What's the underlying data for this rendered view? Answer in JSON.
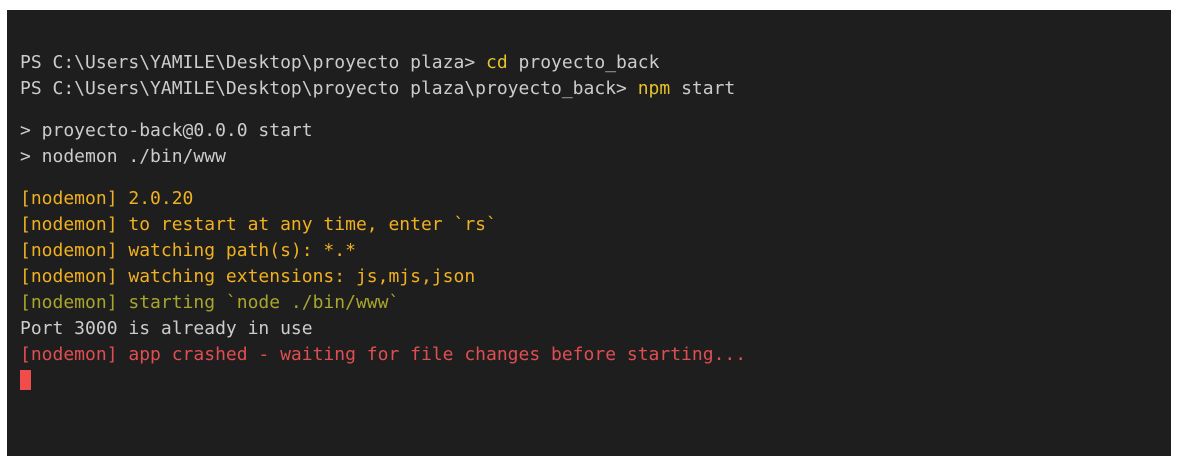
{
  "terminal": {
    "prompt1": {
      "prefix": "PS C:\\Users\\YAMILE\\Desktop\\proyecto plaza> ",
      "command": "cd",
      "args": " proyecto_back"
    },
    "prompt2": {
      "prefix": "PS C:\\Users\\YAMILE\\Desktop\\proyecto plaza\\proyecto_back> ",
      "command": "npm",
      "args": " start"
    },
    "npm_lines": [
      "> proyecto-back@0.0.0 start",
      "> nodemon ./bin/www"
    ],
    "nodemon_info": [
      "[nodemon] 2.0.20",
      "[nodemon] to restart at any time, enter `rs`",
      "[nodemon] watching path(s): *.*",
      "[nodemon] watching extensions: js,mjs,json"
    ],
    "nodemon_start": "[nodemon] starting `node ./bin/www`",
    "port_message": "Port 3000 is already in use",
    "crash_message": "[nodemon] app crashed - waiting for file changes before starting..."
  },
  "colors": {
    "background": "#1e1e1e",
    "text": "#cccccc",
    "command": "#e5c12a",
    "nodemon_info": "#f0b020",
    "nodemon_start": "#a8a62c",
    "error": "#e14e51",
    "cursor": "#f14c4c"
  }
}
